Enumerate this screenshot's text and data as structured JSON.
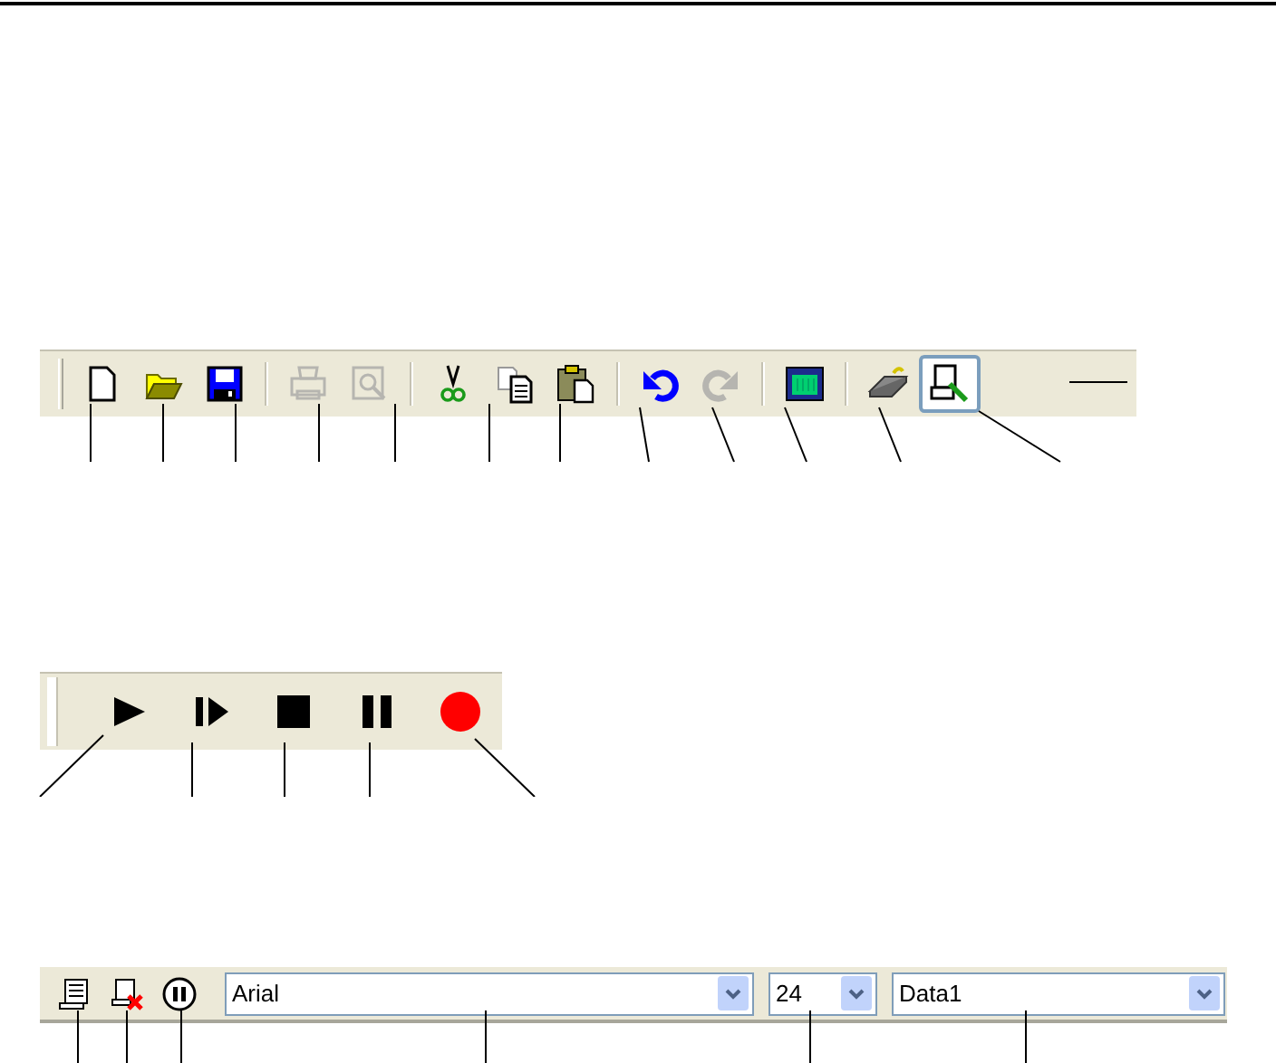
{
  "standard_toolbar": {
    "buttons": [
      {
        "kind": "new",
        "disabled": false,
        "selected": false
      },
      {
        "kind": "open",
        "disabled": false,
        "selected": false
      },
      {
        "kind": "save",
        "disabled": false,
        "selected": false
      },
      {
        "kind": "print",
        "disabled": true,
        "selected": false
      },
      {
        "kind": "preview",
        "disabled": true,
        "selected": false
      },
      {
        "kind": "cut",
        "disabled": false,
        "selected": false
      },
      {
        "kind": "copy",
        "disabled": false,
        "selected": false
      },
      {
        "kind": "paste",
        "disabled": false,
        "selected": false
      },
      {
        "kind": "undo",
        "disabled": false,
        "selected": false
      },
      {
        "kind": "redo",
        "disabled": true,
        "selected": false
      },
      {
        "kind": "screen",
        "disabled": false,
        "selected": false
      },
      {
        "kind": "keyboard",
        "disabled": false,
        "selected": false
      },
      {
        "kind": "tool",
        "disabled": false,
        "selected": true
      }
    ]
  },
  "playback_toolbar": {
    "buttons": [
      {
        "kind": "play"
      },
      {
        "kind": "step"
      },
      {
        "kind": "stop"
      },
      {
        "kind": "pause"
      },
      {
        "kind": "record"
      }
    ]
  },
  "text_toolbar": {
    "buttons": [
      {
        "kind": "script"
      },
      {
        "kind": "script-delete"
      },
      {
        "kind": "pause-circle"
      }
    ],
    "font_combo": {
      "value": "Arial"
    },
    "size_combo": {
      "value": "24"
    },
    "data_combo": {
      "value": "Data1"
    }
  }
}
